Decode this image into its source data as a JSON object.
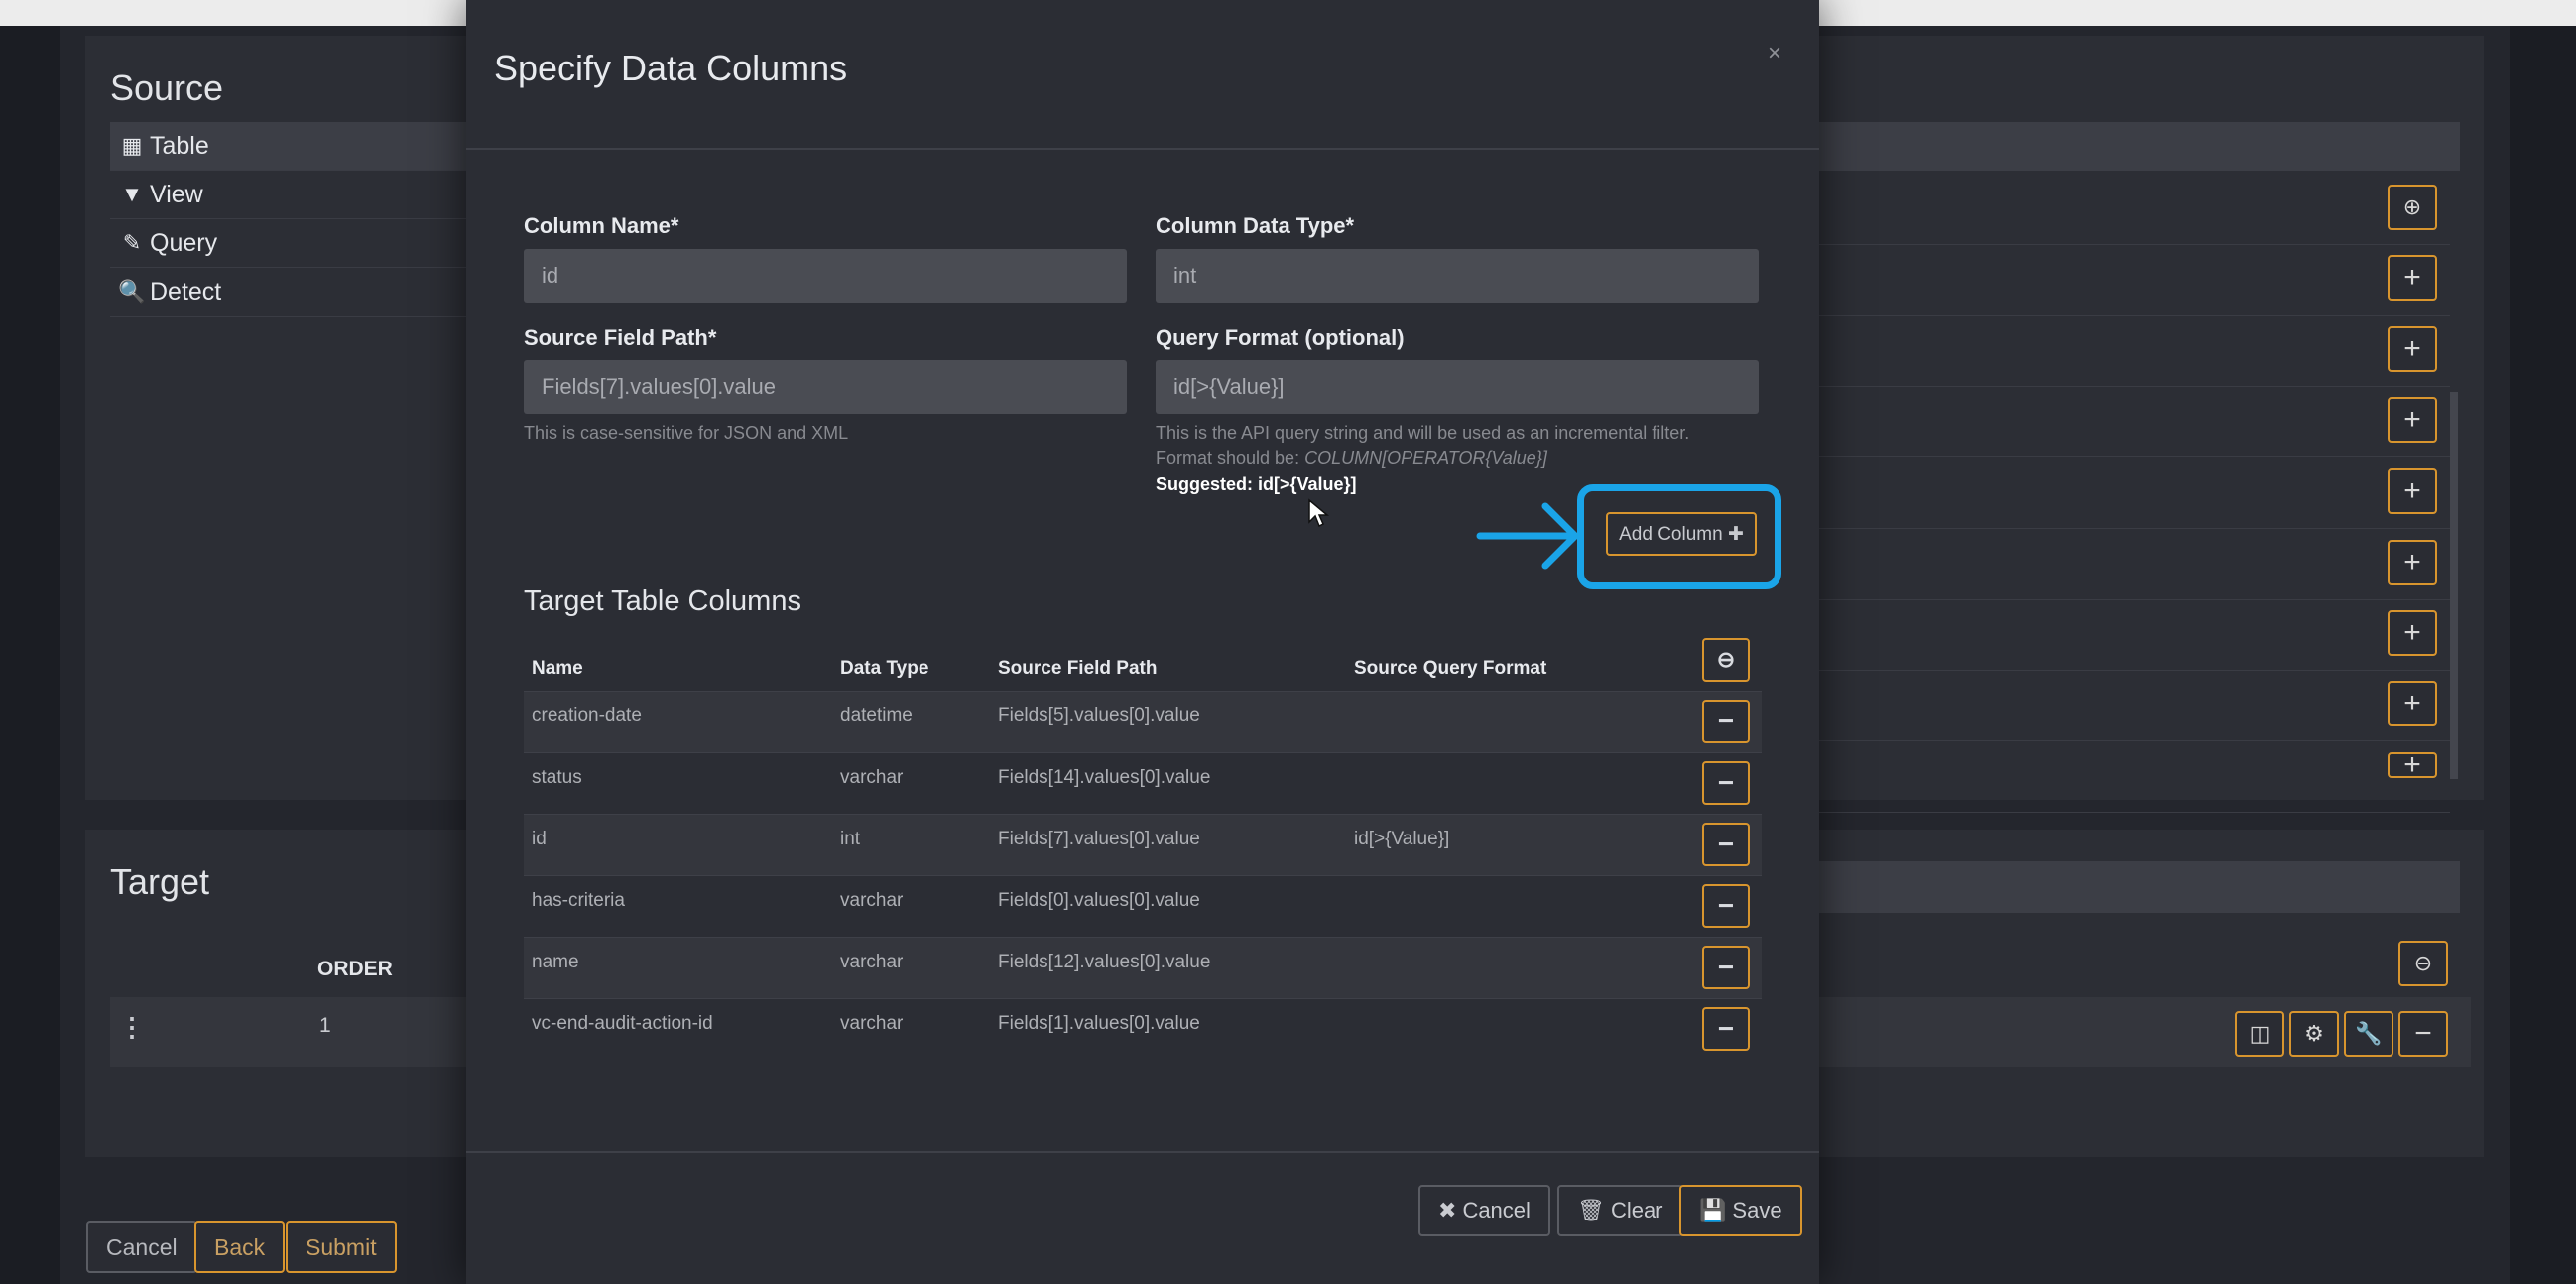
{
  "background": {
    "source": {
      "title": "Source",
      "items": [
        {
          "icon": "table-icon",
          "glyph": "▦",
          "label": "Table"
        },
        {
          "icon": "filter-icon",
          "glyph": "▼",
          "label": "View"
        },
        {
          "icon": "edit-icon",
          "glyph": "✎",
          "label": "Query"
        },
        {
          "icon": "search-icon",
          "glyph": "🔍",
          "label": "Detect"
        }
      ]
    },
    "target": {
      "title": "Target",
      "order_header": "ORDER",
      "order_value": "1"
    },
    "footer": {
      "cancel": "Cancel",
      "back": "Back",
      "submit": "Submit"
    }
  },
  "modal": {
    "title": "Specify Data Columns",
    "close": "×",
    "column_name": {
      "label": "Column Name*",
      "value": "id"
    },
    "column_data_type": {
      "label": "Column Data Type*",
      "value": "int"
    },
    "source_field_path": {
      "label": "Source Field Path*",
      "value": "Fields[7].values[0].value",
      "help": "This is case-sensitive for JSON and XML"
    },
    "query_format": {
      "label": "Query Format (optional)",
      "value": "id[>{Value}]",
      "help_line1": "This is the API query string and will be used as an incremental filter.",
      "help_line2_prefix": "Format should be: ",
      "help_line2_format": "COLUMN[OPERATOR{Value}]",
      "suggested": "Suggested: id[>{Value}]"
    },
    "add_column": "Add Column ✚",
    "table_title": "Target Table Columns",
    "table_headers": [
      "Name",
      "Data Type",
      "Source Field Path",
      "Source Query Format"
    ],
    "rows": [
      {
        "name": "creation-date",
        "type": "datetime",
        "path": "Fields[5].values[0].value",
        "query": ""
      },
      {
        "name": "status",
        "type": "varchar",
        "path": "Fields[14].values[0].value",
        "query": ""
      },
      {
        "name": "id",
        "type": "int",
        "path": "Fields[7].values[0].value",
        "query": "id[>{Value}]"
      },
      {
        "name": "has-criteria",
        "type": "varchar",
        "path": "Fields[0].values[0].value",
        "query": ""
      },
      {
        "name": "name",
        "type": "varchar",
        "path": "Fields[12].values[0].value",
        "query": ""
      },
      {
        "name": "vc-end-audit-action-id",
        "type": "varchar",
        "path": "Fields[1].values[0].value",
        "query": ""
      }
    ],
    "footer": {
      "cancel": "Cancel",
      "clear": "Clear",
      "save": "Save"
    }
  },
  "colors": {
    "accent": "#d8952e",
    "highlight": "#1aa4e8"
  }
}
